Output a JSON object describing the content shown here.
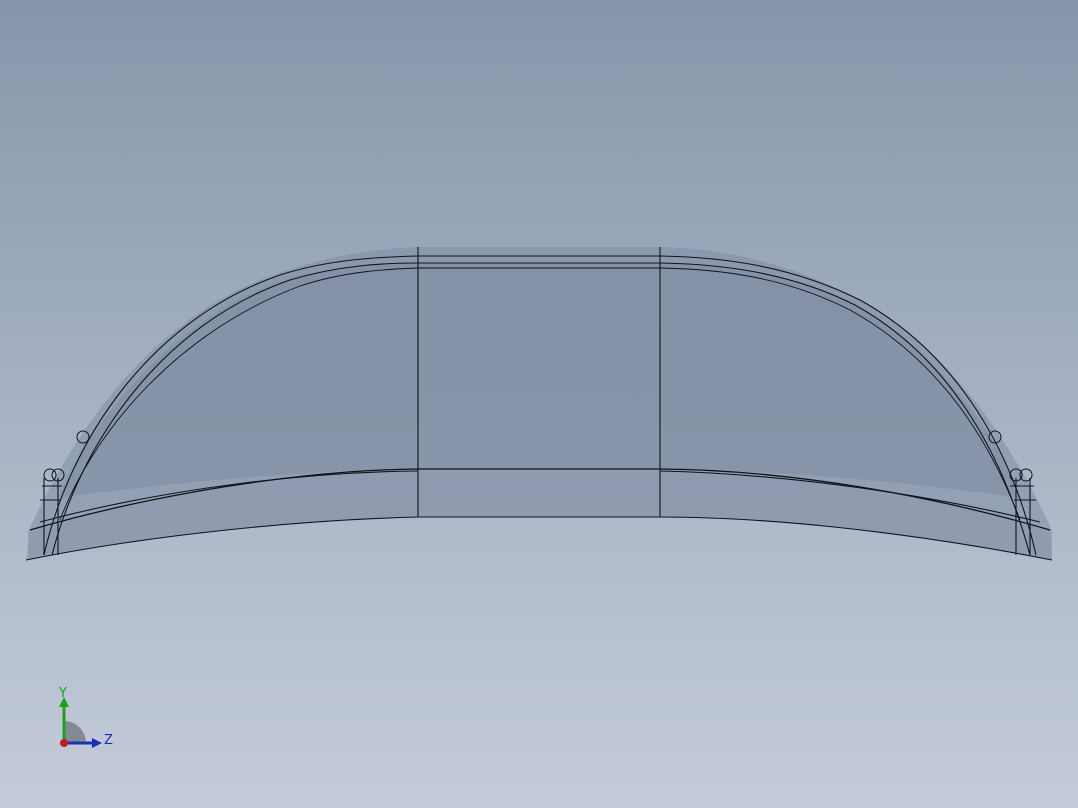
{
  "viewport": {
    "title": "",
    "background_top": "#8696aa",
    "background_bottom": "#c4ccd9"
  },
  "model": {
    "display_mode": "shaded-with-edges-transparent",
    "fill_color": "#7e8aa0",
    "edge_color": "#0f141c"
  },
  "triad": {
    "y_label": "Y",
    "z_label": "Z",
    "y_color": "#1aa31a",
    "z_color": "#1a2fb8",
    "x_color": "#c81a1a"
  }
}
